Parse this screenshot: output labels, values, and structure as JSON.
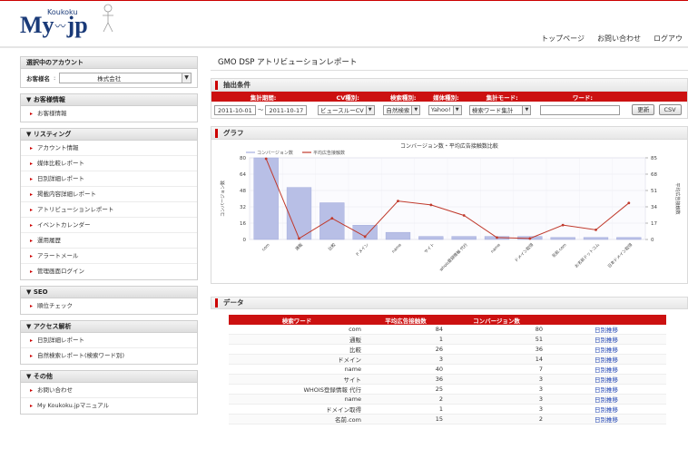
{
  "header": {
    "logo_my": "My",
    "logo_sub": "Koukoku",
    "logo_jp": "jp",
    "nav": [
      "トップページ",
      "お問い合わせ",
      "ログアウ"
    ]
  },
  "sidebar": {
    "account_panel_title": "選択中のアカウント",
    "account_label": "お客様名",
    "account_value": "株式会社",
    "sections": [
      {
        "title": "▼ お客様情報",
        "items": [
          "お客様情報"
        ]
      },
      {
        "title": "▼ リスティング",
        "items": [
          "アカウント情報",
          "媒体比較レポート",
          "日別詳細レポート",
          "掲載内容詳細レポート",
          "アトリビューションレポート",
          "イベントカレンダー",
          "運用履歴",
          "アラートメール",
          "管理画面ログイン"
        ]
      },
      {
        "title": "▼ SEO",
        "items": [
          "順位チェック"
        ]
      },
      {
        "title": "▼ アクセス解析",
        "items": [
          "日別詳細レポート",
          "自然検索レポート(検索ワード別)"
        ]
      },
      {
        "title": "▼ その他",
        "items": [
          "お問い合わせ",
          "My Koukoku.jpマニュアル"
        ]
      }
    ]
  },
  "main": {
    "page_title": "GMO DSP アトリビューションレポート",
    "cond_title": "抽出条件",
    "cond_headers": [
      "集計期間:",
      "CV種別:",
      "検索種別:",
      "媒体種別:",
      "集計モード:",
      "ワード:"
    ],
    "date_from": "2011-10-01",
    "date_sep": "～",
    "date_to": "2011-10-17",
    "cv_type": "ビュースルーCV",
    "search_type": "自然検索",
    "media_type": "Yahoo!",
    "mode": "検索ワード集計",
    "word_value": "",
    "update_button": "更新",
    "csv_button": "CSV",
    "graph_title": "グラフ",
    "table_title": "データ"
  },
  "chart_data": {
    "type": "bar",
    "title": "コンバージョン数・平均広告接触数比較",
    "legend": [
      "コンバージョン数",
      "平均広告接触数"
    ],
    "legend_colors": [
      "#b8bfe6",
      "#c0392b"
    ],
    "categories": [
      "com",
      "通販",
      "比較",
      "ドメイン",
      "name",
      "サイト",
      "whois登録情報 代行",
      "name",
      "ドメイン取得",
      "名前.com",
      "お名前ドットコム",
      "日本ドメイン取得"
    ],
    "series": [
      {
        "name": "コンバージョン数",
        "axis": "left",
        "values": [
          80,
          51,
          36,
          14,
          7,
          3,
          3,
          3,
          3,
          2,
          2,
          2
        ]
      },
      {
        "name": "平均広告接触数",
        "axis": "right",
        "values": [
          84,
          1,
          22,
          3,
          40,
          36,
          25,
          2,
          1,
          15,
          10,
          38
        ]
      }
    ],
    "ylabel_left": "コンバージョン数",
    "ylabel_right": "平均広告接触数",
    "ylim_left": [
      0,
      80
    ],
    "yticks_left": [
      0,
      16,
      32,
      48,
      64,
      80
    ],
    "ylim_right": [
      0,
      85
    ],
    "yticks_right": [
      0,
      17,
      34,
      51,
      68,
      85
    ],
    "grid": true,
    "legend_position": "top-left"
  },
  "table": {
    "headers": [
      "検索ワード",
      "平均広告接触数",
      "コンバージョン数",
      ""
    ],
    "rows": [
      [
        "com",
        "84",
        "80",
        "日別推移"
      ],
      [
        "通販",
        "1",
        "51",
        "日別推移"
      ],
      [
        "比較",
        "26",
        "36",
        "日別推移"
      ],
      [
        "ドメイン",
        "3",
        "14",
        "日別推移"
      ],
      [
        "name",
        "40",
        "7",
        "日別推移"
      ],
      [
        "サイト",
        "36",
        "3",
        "日別推移"
      ],
      [
        "WHOIS登録情報 代行",
        "25",
        "3",
        "日別推移"
      ],
      [
        "name",
        "2",
        "3",
        "日別推移"
      ],
      [
        "ドメイン取得",
        "1",
        "3",
        "日別推移"
      ],
      [
        "名前.com",
        "15",
        "2",
        "日別推移"
      ]
    ]
  }
}
